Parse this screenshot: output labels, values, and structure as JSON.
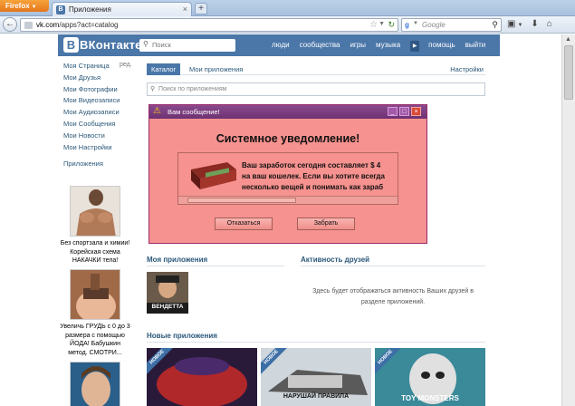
{
  "browser": {
    "menu_button": "Firefox",
    "tab_title": "Приложения",
    "url_host": "vk.com",
    "url_path": "/apps?act=catalog",
    "search_placeholder": "Google"
  },
  "vk": {
    "logo": "ВКонтакте",
    "search_placeholder": "Поиск",
    "menu": [
      "люди",
      "сообщества",
      "игры",
      "музыка",
      "помощь",
      "выйти"
    ]
  },
  "sidebar": {
    "items": [
      "Моя Страница",
      "Мои Друзья",
      "Мои Фотографии",
      "Мои Видеозаписи",
      "Мои Аудиозаписи",
      "Мои Сообщения",
      "Мои Новости",
      "Мои Настройки"
    ],
    "edit": "ред.",
    "apps": "Приложения"
  },
  "ads": [
    {
      "text": "Без спортзала и химии! Корейская схема НАКАЧКИ тела!"
    },
    {
      "text": "Увеличь ГРУДЬ с 0 до 3 размера с помощью ЙОДА! Бабушкин метод. СМОТРИ..."
    }
  ],
  "catalog": {
    "tab_catalog": "Каталог",
    "tab_my_apps": "Мои приложения",
    "settings": "Настройки",
    "search_placeholder": "Поиск по приложениям"
  },
  "popup": {
    "title": "Вам сообщение!",
    "heading": "Системное уведомление!",
    "line1": "Ваш заработок сегодня составляет $ 4",
    "line2": "на ваш кошелек. Если вы хотите всегда",
    "line3": "несколько вещей и понимать как зараб",
    "cancel": "Отказаться",
    "take": "Забрать",
    "bg_color": "#f6928f",
    "title_color": "#7a3b80"
  },
  "sections": {
    "my_apps": "Моя приложения",
    "my_app_caption": "ВЕНДЕТТА",
    "friends": "Активность друзей",
    "friends_text": "Здесь будет отображаться активность Ваших друзей в разделе приложений.",
    "new_apps": "Новые приложения",
    "ribbon": "НОВОЕ",
    "app2_caption": "НАРУШАЙ ПРАВИЛА",
    "app3_caption": "TOY MONSTERS"
  },
  "colors": {
    "vk_blue": "#4a76a8",
    "link": "#2b587a"
  }
}
